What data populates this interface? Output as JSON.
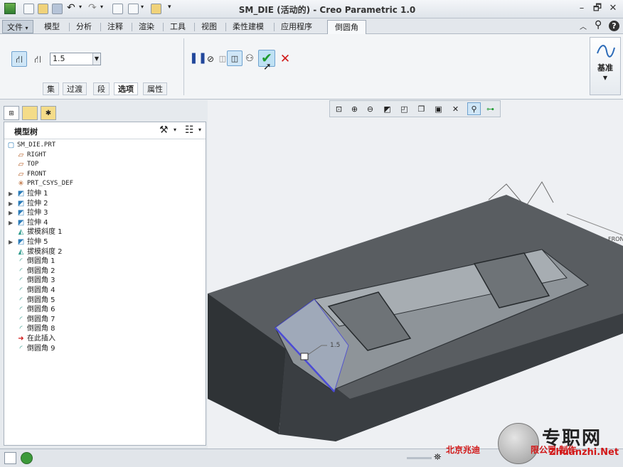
{
  "window": {
    "title": "SM_DIE (活动的) - Creo Parametric 1.0",
    "controls": [
      "–",
      "🗗",
      "✕"
    ]
  },
  "ribbon": {
    "file_label": "文件",
    "tabs": [
      "模型",
      "分析",
      "注释",
      "渲染",
      "工具",
      "视图",
      "柔性建模",
      "应用程序",
      "倒圆角"
    ],
    "active_tab": "倒圆角",
    "radius_value": "1.5",
    "subtabs": [
      "集",
      "过渡",
      "段",
      "选项",
      "属性"
    ],
    "active_subtab": "选项",
    "datum_label": "基准"
  },
  "model_tree": {
    "title": "模型树",
    "items": [
      {
        "label": "SM_DIE.PRT",
        "icon": "part-icon",
        "expandable": false,
        "mono": true
      },
      {
        "label": "RIGHT",
        "icon": "datum-plane-icon",
        "expandable": false,
        "mono": true
      },
      {
        "label": "TOP",
        "icon": "datum-plane-icon",
        "expandable": false,
        "mono": true
      },
      {
        "label": "FRONT",
        "icon": "datum-plane-icon",
        "expandable": false,
        "mono": true
      },
      {
        "label": "PRT_CSYS_DEF",
        "icon": "csys-icon",
        "expandable": false,
        "mono": true
      },
      {
        "label": "拉伸 1",
        "icon": "extrude-icon",
        "expandable": true
      },
      {
        "label": "拉伸 2",
        "icon": "extrude-icon",
        "expandable": true
      },
      {
        "label": "拉伸 3",
        "icon": "extrude-icon",
        "expandable": true
      },
      {
        "label": "拉伸 4",
        "icon": "extrude-icon",
        "expandable": true
      },
      {
        "label": "拔模斜度 1",
        "icon": "draft-icon",
        "expandable": false
      },
      {
        "label": "拉伸 5",
        "icon": "extrude-icon",
        "expandable": true
      },
      {
        "label": "拔模斜度 2",
        "icon": "draft-icon",
        "expandable": false
      },
      {
        "label": "倒圆角 1",
        "icon": "round-icon",
        "expandable": false
      },
      {
        "label": "倒圆角 2",
        "icon": "round-icon",
        "expandable": false
      },
      {
        "label": "倒圆角 3",
        "icon": "round-icon",
        "expandable": false
      },
      {
        "label": "倒圆角 4",
        "icon": "round-icon",
        "expandable": false
      },
      {
        "label": "倒圆角 5",
        "icon": "round-icon",
        "expandable": false
      },
      {
        "label": "倒圆角 6",
        "icon": "round-icon",
        "expandable": false
      },
      {
        "label": "倒圆角 7",
        "icon": "round-icon",
        "expandable": false
      },
      {
        "label": "倒圆角 8",
        "icon": "round-icon",
        "expandable": false
      },
      {
        "label": "在此插入",
        "icon": "insert-here-icon",
        "expandable": false
      },
      {
        "label": "倒圆角 9",
        "icon": "round-icon",
        "expandable": false
      }
    ]
  },
  "viewport": {
    "dimension_label": "1.5",
    "datum_tag": "FRON"
  },
  "watermark": {
    "left_text": "北京兆迪",
    "right_text": "限公司 制作",
    "site_cn": "专职网",
    "site_url": "Zhuanzhi.Net"
  },
  "colors": {
    "accent": "#4a7fc1",
    "confirm_green": "#1e9b2e",
    "cancel_red": "#d01818",
    "highlight_edge": "#4b4bd6"
  }
}
